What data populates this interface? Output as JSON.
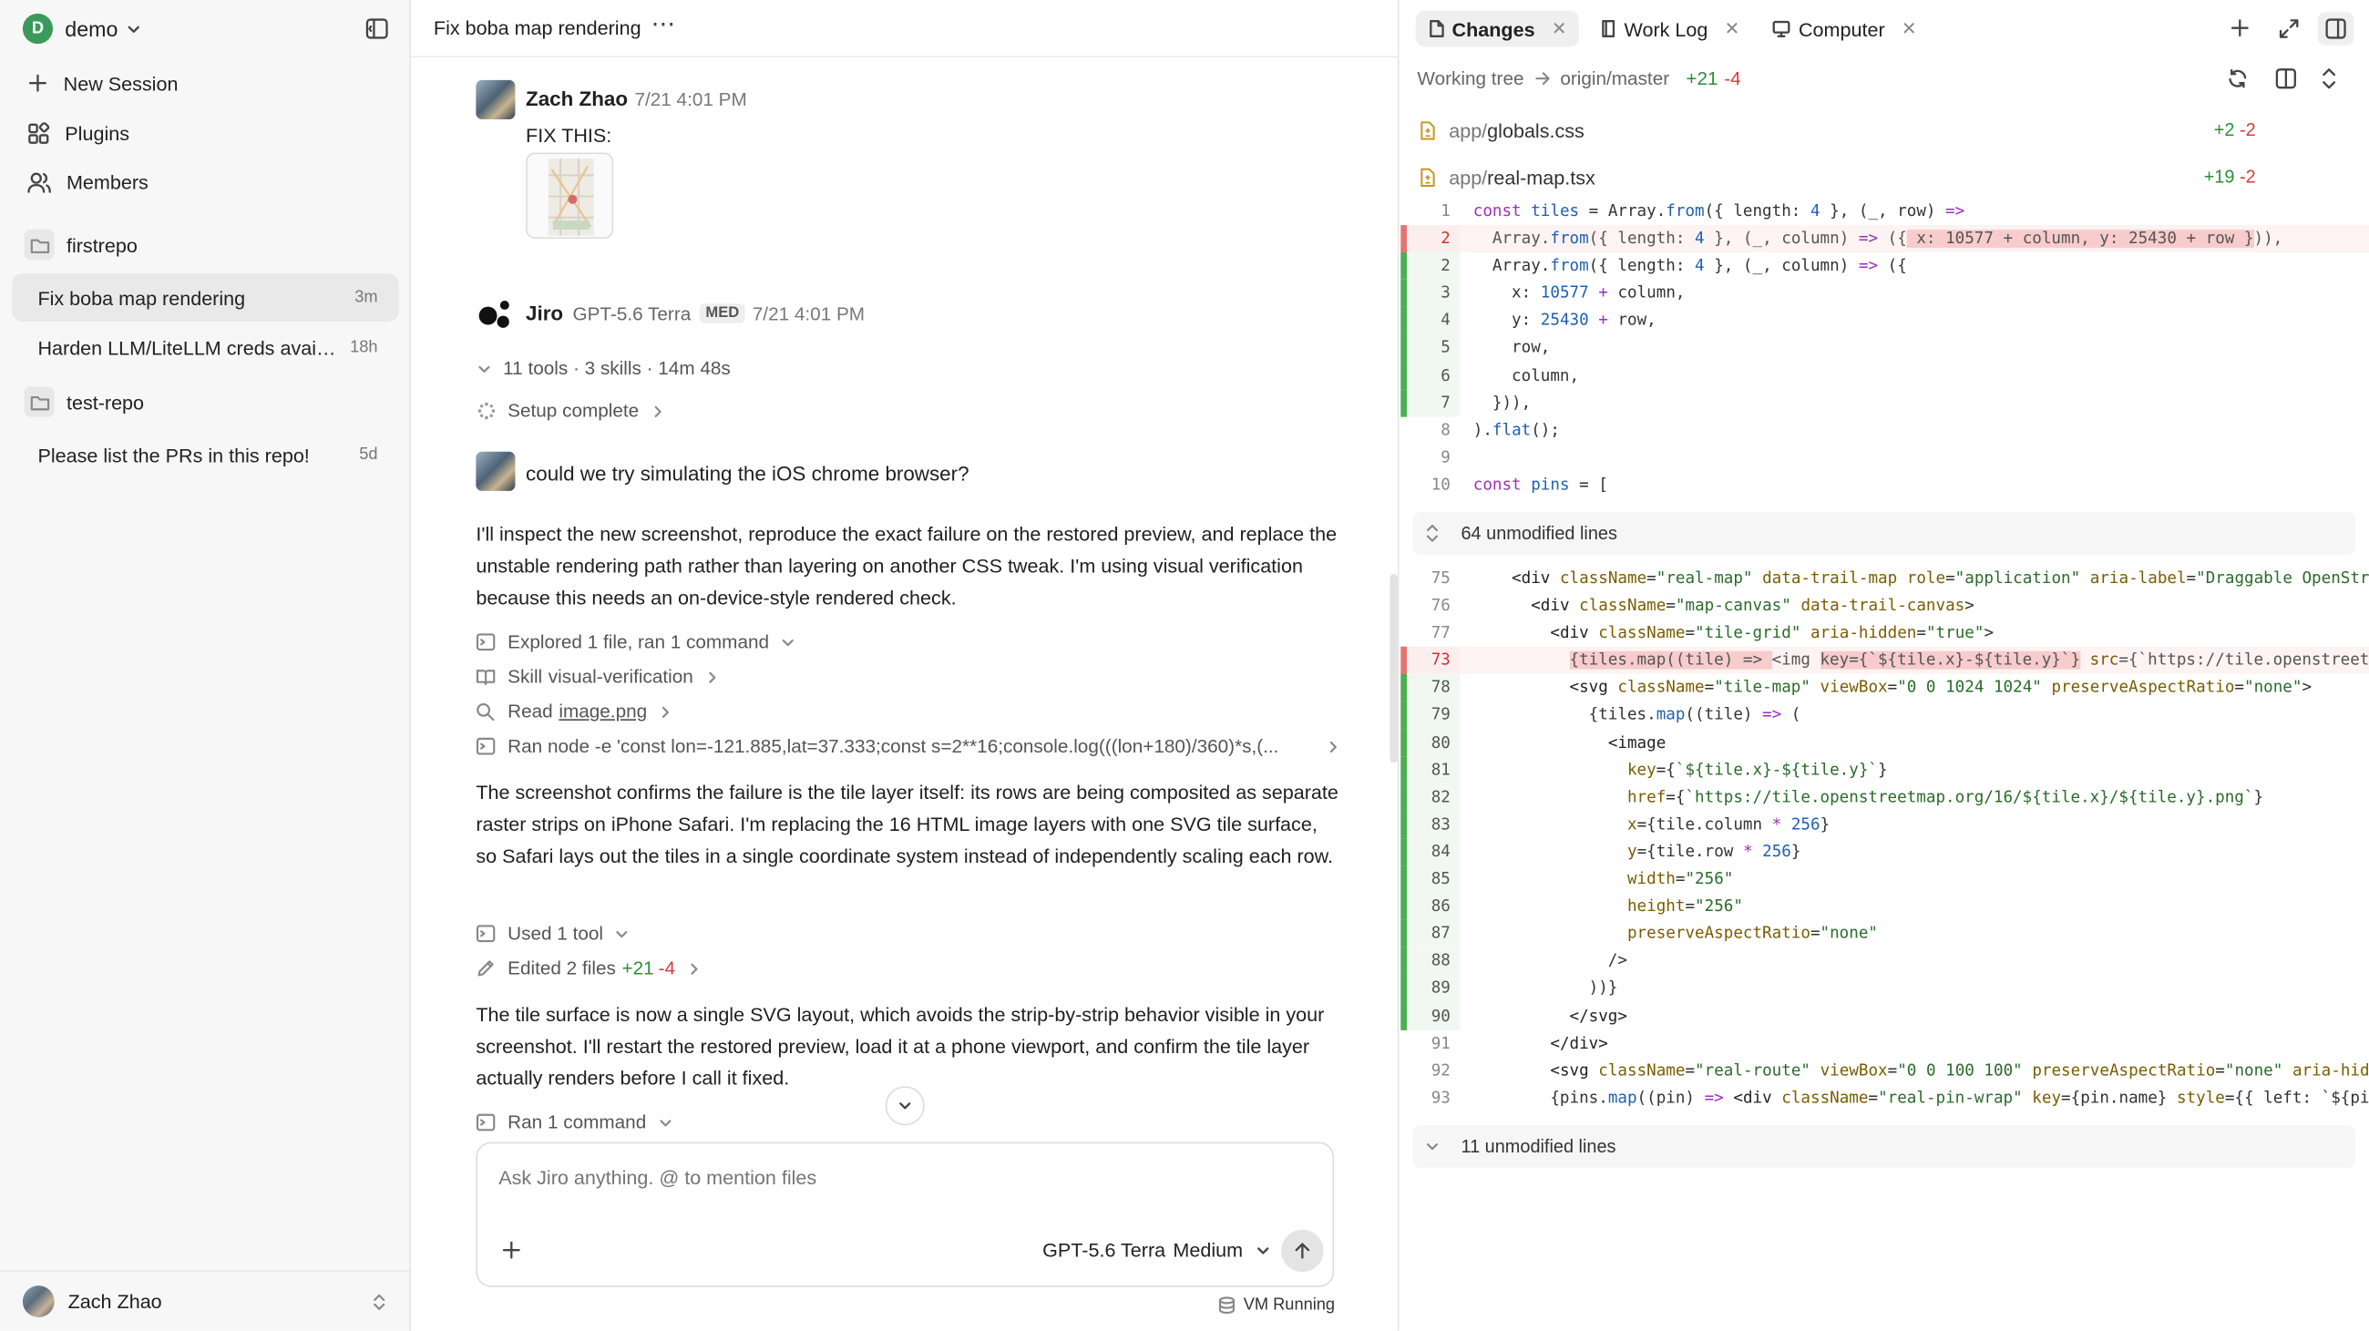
{
  "workspace": {
    "avatar_letter": "D",
    "name": "demo"
  },
  "sidebar": {
    "nav": [
      {
        "label": "New Session",
        "icon": "plus-icon"
      },
      {
        "label": "Plugins",
        "icon": "plugins-icon"
      },
      {
        "label": "Members",
        "icon": "members-icon"
      }
    ],
    "repos": [
      {
        "name": "firstrepo",
        "sessions": [
          {
            "title": "Fix boba map rendering",
            "age": "3m",
            "active": true
          },
          {
            "title": "Harden LLM/LiteLLM creds availa...",
            "age": "18h"
          }
        ]
      },
      {
        "name": "test-repo",
        "sessions": [
          {
            "title": "Please list the PRs in this repo!",
            "age": "5d"
          }
        ]
      }
    ],
    "user": {
      "name": "Zach Zhao"
    }
  },
  "chat": {
    "title": "Fix boba map rendering",
    "msg1": {
      "author": "Zach Zhao",
      "time": "7/21 4:01 PM",
      "text": "FIX THIS:"
    },
    "agent": {
      "name": "Jiro",
      "model": "GPT-5.6 Terra",
      "badge": "MED",
      "time": "7/21 4:01 PM"
    },
    "tools_summary": "11 tools · 3 skills · 14m 48s",
    "setup": "Setup complete",
    "msg2": "could we try simulating the iOS chrome browser?",
    "para1": "I'll inspect the new screenshot, reproduce the exact failure on the restored preview, and replace the unstable rendering path rather than layering on another CSS tweak. I'm using visual verification because this needs an on-device-style rendered check.",
    "steps": {
      "explored": "Explored 1 file, ran 1 command",
      "skill_prefix": "Skill",
      "skill": "visual-verification",
      "read_prefix": "Read",
      "read_file": "image.png",
      "ran": "Ran node -e 'const lon=-121.885,lat=37.333;const s=2**16;console.log(((lon+180)/360)*s,(..."
    },
    "para2": "The screenshot confirms the failure is the tile layer itself: its rows are being composited as separate raster strips on iPhone Safari. I'm replacing the 16 HTML image layers with one SVG tile surface, so Safari lays out the tiles in a single coordinate system instead of independently scaling each row.",
    "used_tool": "Used 1 tool",
    "edited": {
      "label": "Edited 2 files",
      "add": "+21",
      "del": "-4"
    },
    "para3": "The tile surface is now a single SVG layout, which avoids the strip-by-strip behavior visible in your screenshot. I'll restart the restored preview, load it at a phone viewport, and confirm the tile layer actually renders before I call it fixed.",
    "ran_cmd": "Ran 1 command",
    "composer": {
      "placeholder": "Ask Jiro anything. @ to mention files",
      "model": "GPT-5.6 Terra",
      "effort": "Medium"
    },
    "vm_status": "VM Running"
  },
  "changes": {
    "tabs": [
      {
        "label": "Changes",
        "active": true
      },
      {
        "label": "Work Log"
      },
      {
        "label": "Computer"
      }
    ],
    "branch": {
      "from": "Working tree",
      "to": "origin/master",
      "add": "+21",
      "del": "-4"
    },
    "files": [
      {
        "dir": "app/",
        "name": "globals.css",
        "add": "+2",
        "del": "-2"
      },
      {
        "dir": "app/",
        "name": "real-map.tsx",
        "add": "+19",
        "del": "-2"
      }
    ],
    "fold1": "64 unmodified lines",
    "fold2": "11 unmodified lines"
  }
}
